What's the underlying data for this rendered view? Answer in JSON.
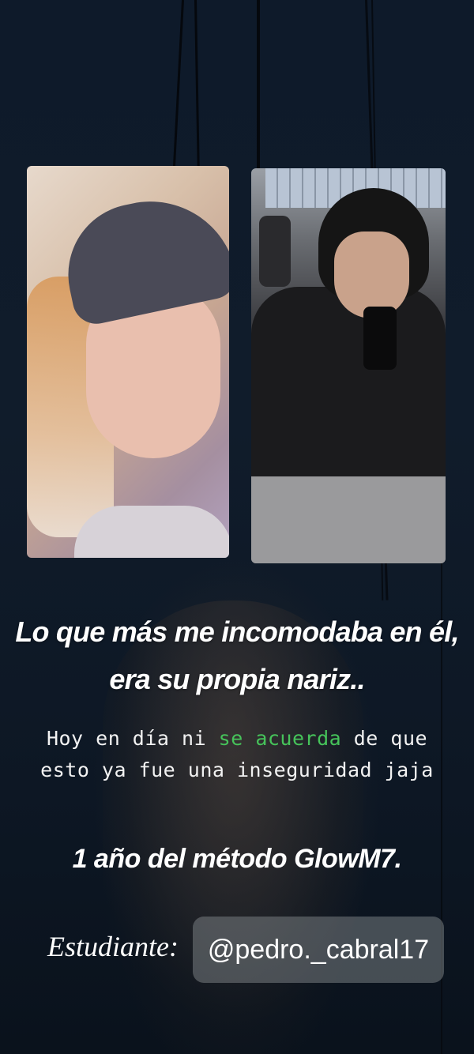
{
  "story": {
    "headline_line1": "Lo que más me incomodaba en él,",
    "headline_line2": "era su propia nariz..",
    "body_line1_a": "Hoy en día ni ",
    "body_line1_highlight": "se acuerda",
    "body_line1_b": " de que",
    "body_line2": "esto ya fue una inseguridad jaja",
    "method_line": "1 año del método GlowM7.",
    "student_label": "Estudiante:",
    "student_handle": "@pedro._cabral17"
  },
  "colors": {
    "background": "#0f1a28",
    "highlight": "#46c35a",
    "text": "#ffffff"
  }
}
